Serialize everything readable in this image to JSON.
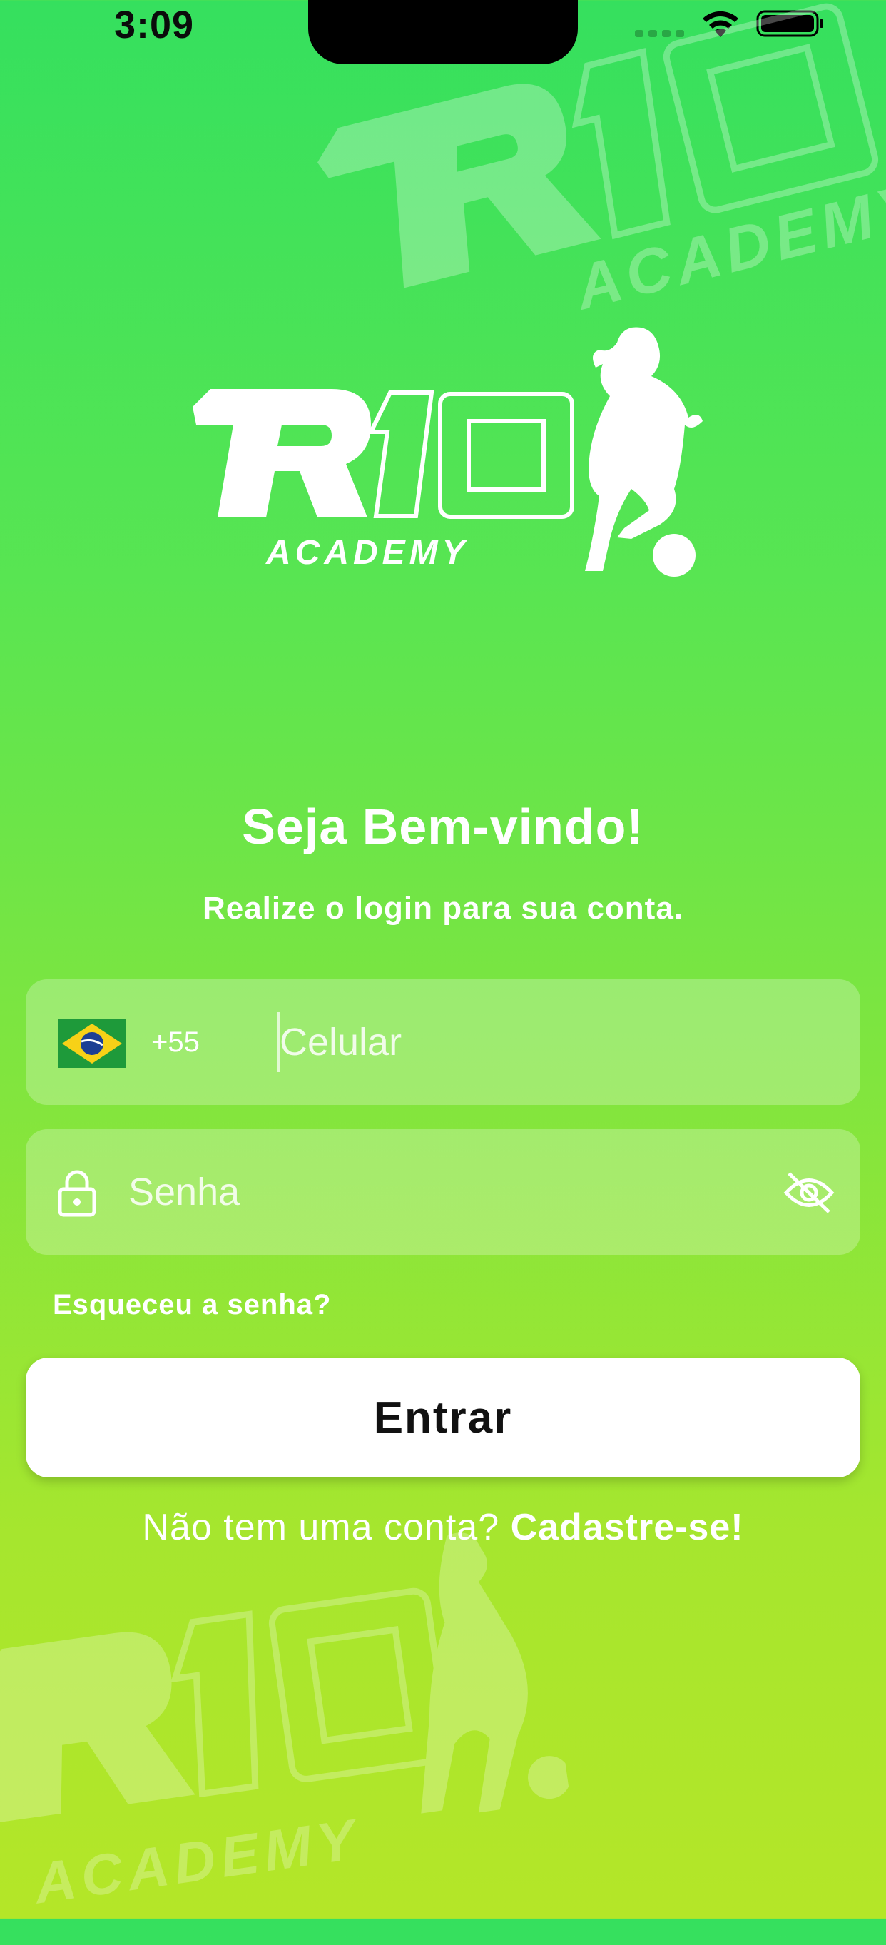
{
  "status_bar": {
    "time": "3:09"
  },
  "logo": {
    "brand": "R10",
    "sub": "ACADEMY",
    "icon": "football-player-icon"
  },
  "welcome": {
    "title": "Seja Bem-vindo!",
    "subtitle": "Realize o login para sua conta."
  },
  "phone_field": {
    "flag": "brazil-flag-icon",
    "country_code": "+55",
    "placeholder": "Celular",
    "value": ""
  },
  "password_field": {
    "icon": "lock-icon",
    "placeholder": "Senha",
    "value": "",
    "toggle_icon": "eye-off-icon"
  },
  "forgot_password": "Esqueceu a senha?",
  "enter_button": "Entrar",
  "signup": {
    "prompt": "Não tem uma conta?",
    "link": "Cadastre-se!"
  },
  "colors": {
    "gradient_top": "#35e05e",
    "gradient_bottom": "#b4e628",
    "button_bg": "#ffffff",
    "button_text": "#111111"
  }
}
